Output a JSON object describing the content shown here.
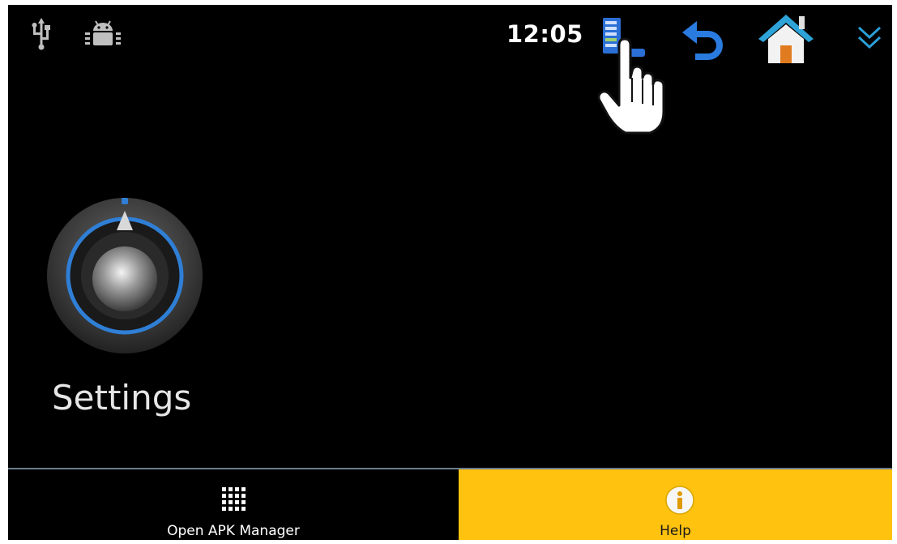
{
  "status_bar": {
    "clock": "12:05",
    "icons": [
      "usb-icon",
      "android-debug-icon",
      "apk-manager-icon",
      "back-icon",
      "home-icon",
      "collapse-chevron-icon"
    ]
  },
  "desktop": {
    "settings_label": "Settings",
    "settings_icon": "settings-knob-icon"
  },
  "bottom_bar": {
    "open_apk_label": "Open APK Manager",
    "help_label": "Help",
    "help_color": "#ffc20e",
    "open_apk_icon": "grid-icon",
    "help_icon": "info-icon"
  },
  "accent_color": "#2f7fd6"
}
